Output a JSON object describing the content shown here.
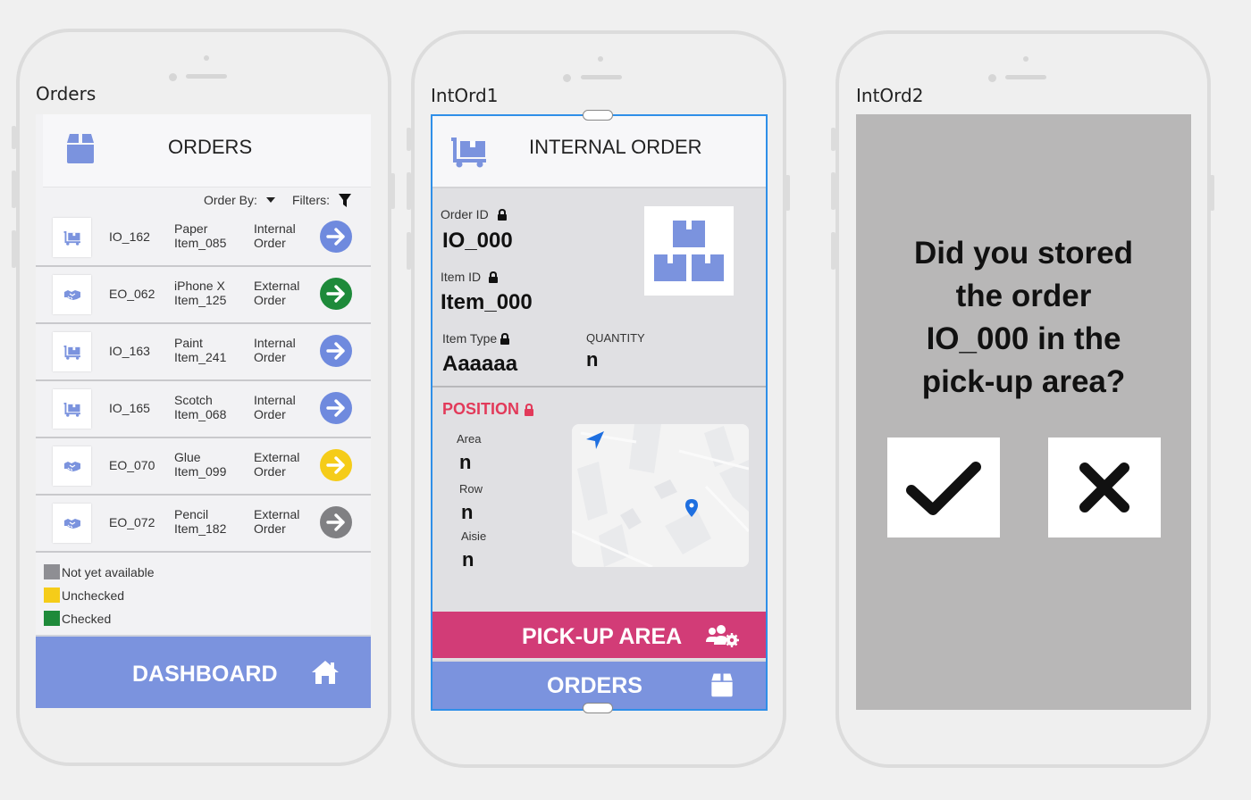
{
  "frames": [
    {
      "title": "Orders"
    },
    {
      "title": "IntOrd1"
    },
    {
      "title": "IntOrd2"
    }
  ],
  "orders_screen": {
    "header": {
      "title": "ORDERS",
      "icon": "box-icon"
    },
    "order_by_label": "Order By:",
    "filters_label": "Filters:",
    "rows": [
      {
        "id": "IO_162",
        "name_line1": "Paper",
        "name_line2": "Item_085",
        "type_line1": "Internal",
        "type_line2": "Order",
        "thumb_icon": "dolly-icon",
        "status_color": "#6f8ade"
      },
      {
        "id": "EO_062",
        "name_line1": "iPhone X",
        "name_line2": "Item_125",
        "type_line1": "External",
        "type_line2": "Order",
        "thumb_icon": "handshake-icon",
        "status_color": "#1e8a3a"
      },
      {
        "id": "IO_163",
        "name_line1": "Paint",
        "name_line2": "Item_241",
        "type_line1": "Internal",
        "type_line2": "Order",
        "thumb_icon": "dolly-icon",
        "status_color": "#6f8ade"
      },
      {
        "id": "IO_165",
        "name_line1": "Scotch",
        "name_line2": "Item_068",
        "type_line1": "Internal",
        "type_line2": "Order",
        "thumb_icon": "dolly-icon",
        "status_color": "#6f8ade"
      },
      {
        "id": "EO_070",
        "name_line1": "Glue",
        "name_line2": "Item_099",
        "type_line1": "External",
        "type_line2": "Order",
        "thumb_icon": "handshake-icon",
        "status_color": "#f5cc19"
      },
      {
        "id": "EO_072",
        "name_line1": "Pencil",
        "name_line2": "Item_182",
        "type_line1": "External",
        "type_line2": "Order",
        "thumb_icon": "handshake-icon",
        "status_color": "#808083"
      }
    ],
    "legend": [
      {
        "label": "Not yet available",
        "color": "#8e8e93"
      },
      {
        "label": "Unchecked",
        "color": "#f5cc19"
      },
      {
        "label": "Checked",
        "color": "#1e8a3a"
      }
    ],
    "dashboard_button": {
      "label": "DASHBOARD",
      "icon": "home-icon"
    }
  },
  "internal_order_screen": {
    "header": {
      "title": "INTERNAL ORDER",
      "icon": "dolly-icon"
    },
    "order_id_label": "Order ID",
    "order_id_value": "IO_000",
    "item_id_label": "Item ID",
    "item_id_value": "Item_000",
    "item_type_label": "Item Type",
    "item_type_value": "Aaaaaa",
    "quantity_label": "QUANTITY",
    "quantity_value": "n",
    "position_title": "POSITION",
    "area_label": "Area",
    "area_value": "n",
    "row_label": "Row",
    "row_value": "n",
    "aisle_label": "Aisie",
    "aisle_value": "n",
    "pickup_button": {
      "label": "PICK-UP AREA",
      "icon": "users-cog-icon"
    },
    "orders_button": {
      "label": "ORDERS",
      "icon": "box-icon"
    },
    "accent_color": "#d23c77"
  },
  "confirm_screen": {
    "question_line1": "Did you stored",
    "question_line2": "the order",
    "question_line3": "IO_000 in the",
    "question_line4": "pick-up area?",
    "confirm_icon": "check-icon",
    "cancel_icon": "x-icon"
  }
}
